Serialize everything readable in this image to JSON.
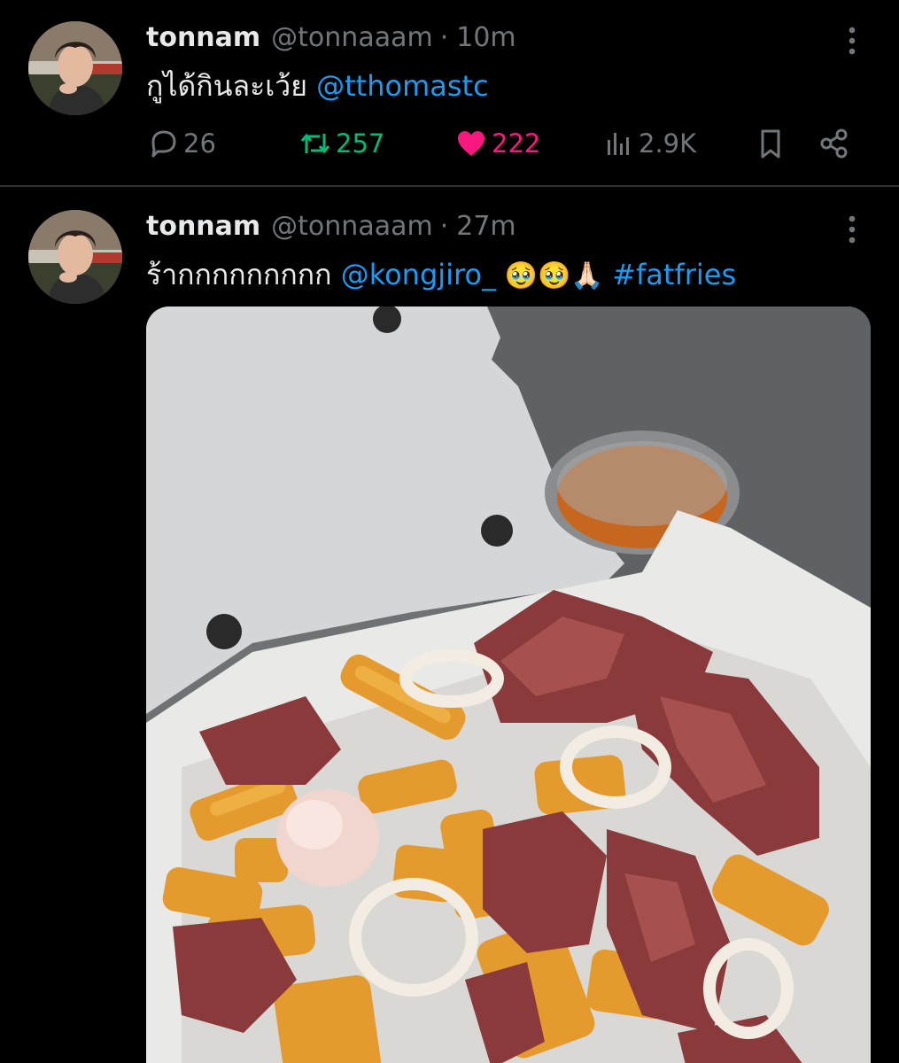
{
  "tweets": [
    {
      "display_name": "tonnam",
      "handle": "@tonnaaam",
      "separator": "·",
      "time": "10m",
      "text_plain": "กูได้กินละเว้ย ",
      "text_mention": "@tthomastc",
      "replies": "26",
      "retweets": "257",
      "likes": "222",
      "views": "2.9K"
    },
    {
      "display_name": "tonnam",
      "handle": "@tonnaaam",
      "separator": "·",
      "time": "27m",
      "text_plain": "ร้ากกกกกกกกก ",
      "text_mention": "@kongjiro_",
      "text_emoji": " 🥹🥹🙏🏻 ",
      "text_hashtag": "#fatfries"
    }
  ],
  "colors": {
    "background": "#000000",
    "text": "#e7e9ea",
    "muted": "#71767b",
    "link": "#1d9bf0",
    "retweet": "#00ba7c",
    "like": "#f91880",
    "divider": "#2f3336"
  },
  "icons": {
    "reply": "speech-bubble-icon",
    "retweet": "retweet-arrows-icon",
    "like": "heart-filled-icon",
    "views": "bar-chart-icon",
    "bookmark": "bookmark-icon",
    "share": "share-nodes-icon",
    "more": "vertical-ellipsis-icon"
  }
}
